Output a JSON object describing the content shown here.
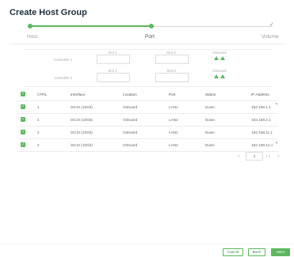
{
  "dialog": {
    "title": "Create Host Group"
  },
  "stepper": {
    "steps": [
      {
        "label": "Host",
        "state": "done"
      },
      {
        "label": "Port",
        "state": "current"
      },
      {
        "label": "Volume",
        "state": "pending"
      }
    ],
    "done_color": "#5cb85c",
    "check_glyph": "✓"
  },
  "controllers": [
    {
      "label": "Controller 1",
      "slot1": "Slot 1",
      "slot2": "Slot 2",
      "onboard": "Onboard"
    },
    {
      "label": "Controller 2",
      "slot1": "Slot 1",
      "slot2": "Slot 3",
      "onboard": "Onboard"
    }
  ],
  "table": {
    "headers": {
      "check": "",
      "ctrl": "CTRL",
      "interface": "Interface",
      "location": "Location",
      "port": "Port",
      "status": "Status",
      "ip": "IP Address"
    },
    "rows": [
      {
        "checked": true,
        "ctrl": "1",
        "interface": "iSCSI (10Gb)",
        "location": "Onboard",
        "port": "LAN1",
        "status": "Down",
        "ip": "192.168.1.1"
      },
      {
        "checked": true,
        "ctrl": "1",
        "interface": "iSCSI (10Gb)",
        "location": "Onboard",
        "port": "LAN2",
        "status": "Down",
        "ip": "192.168.2.1"
      },
      {
        "checked": true,
        "ctrl": "2",
        "interface": "iSCSI (10Gb)",
        "location": "Onboard",
        "port": "LAN1",
        "status": "Down",
        "ip": "192.168.11.1"
      },
      {
        "checked": true,
        "ctrl": "2",
        "interface": "iSCSI (10Gb)",
        "location": "Onboard",
        "port": "LAN2",
        "status": "Down",
        "ip": "192.168.12.1"
      }
    ]
  },
  "pagination": {
    "prev": "<",
    "current_page": "1",
    "of_label": "/ 1",
    "next": ">"
  },
  "footer": {
    "cancel": "Cancel",
    "back": "Back",
    "next": "Next"
  },
  "colors": {
    "accent": "#5cb85c",
    "text": "#1e2f3e"
  }
}
